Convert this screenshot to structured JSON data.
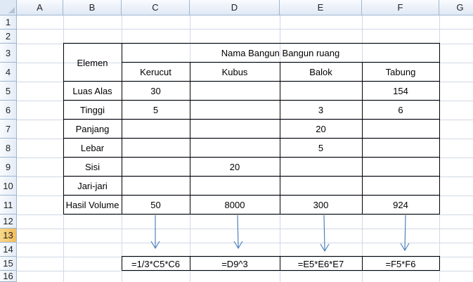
{
  "columns": [
    "A",
    "B",
    "C",
    "D",
    "E",
    "F",
    "G"
  ],
  "rows": [
    "1",
    "2",
    "3",
    "4",
    "5",
    "6",
    "7",
    "8",
    "9",
    "10",
    "11",
    "12",
    "13",
    "14",
    "15",
    "16"
  ],
  "selected_row": "13",
  "table": {
    "header_elemen": "Elemen",
    "header_group": "Nama Bangun Bangun ruang",
    "shapes": [
      "Kerucut",
      "Kubus",
      "Balok",
      "Tabung"
    ],
    "rows": [
      {
        "label": "Luas Alas",
        "values": [
          "30",
          "",
          "",
          "154"
        ]
      },
      {
        "label": "Tinggi",
        "values": [
          "5",
          "",
          "3",
          "6"
        ]
      },
      {
        "label": "Panjang",
        "values": [
          "",
          "",
          "20",
          ""
        ]
      },
      {
        "label": "Lebar",
        "values": [
          "",
          "",
          "5",
          ""
        ]
      },
      {
        "label": "Sisi",
        "values": [
          "",
          "20",
          "",
          ""
        ]
      },
      {
        "label": "Jari-jari",
        "values": [
          "",
          "",
          "",
          ""
        ]
      },
      {
        "label": "Hasil Volume",
        "values": [
          "50",
          "8000",
          "300",
          "924"
        ]
      }
    ]
  },
  "formulas": [
    "=1/3*C5*C6",
    "=D9^3",
    "=E5*E6*E7",
    "=F5*F6"
  ],
  "colors": {
    "arrow": "#4f81bd",
    "header_bg": "#dfe8f5",
    "grid": "#d0d7e5",
    "selected_header": "#f2bd5c"
  }
}
